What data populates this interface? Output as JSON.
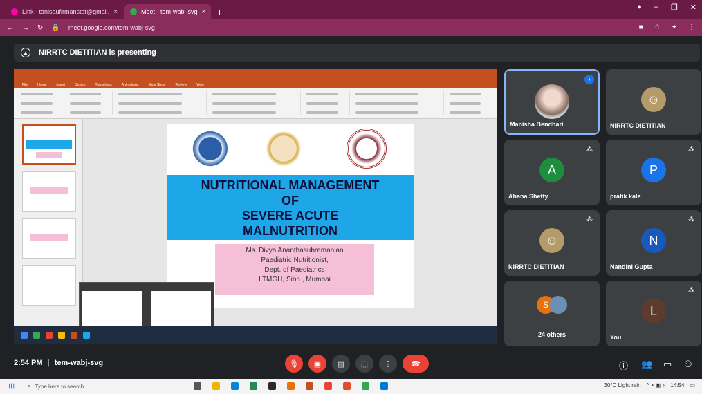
{
  "browser": {
    "tabs": [
      {
        "label": "Link - tanisaufirmanstaf@gmail.",
        "close": "×"
      },
      {
        "label": "Meet - tem-wabj-svg",
        "close": "×"
      }
    ],
    "new_tab": "+",
    "url": "meet.google.com/tem-wabj-svg",
    "window_controls": [
      "●",
      "–",
      "❐",
      "✕"
    ]
  },
  "meet": {
    "presenting_banner": "NIRRTC DIETITIAN is presenting",
    "time": "2:54 PM",
    "meeting_code": "tem-wabj-svg",
    "separator": "|",
    "participants": [
      {
        "name": "Manisha Bendhari",
        "type": "photo",
        "speaking": true
      },
      {
        "name": "NIRRTC DIETITIAN",
        "type": "logo"
      },
      {
        "name": "Ahana Shetty",
        "initial": "A",
        "color": "#1e8e3e"
      },
      {
        "name": "pratik kale",
        "initial": "P",
        "color": "#1a73e8"
      },
      {
        "name": "NIRRTC DIETITIAN",
        "type": "logo"
      },
      {
        "name": "Nandini Gupta",
        "initial": "N",
        "color": "#185abc"
      },
      {
        "name": "24 others",
        "initial": "S",
        "color": "#e8710a"
      },
      {
        "name": "You",
        "initial": "L",
        "color": "#5f3b2e"
      }
    ]
  },
  "slide": {
    "title_lines": [
      "NUTRITIONAL MANAGEMENT",
      "OF",
      "SEVERE ACUTE",
      "MALNUTRITION"
    ],
    "presenter_lines": [
      "Ms. Divya Ananthasubramanian",
      "Paediatric Nutritionist,",
      "Dept. of Paediatrics",
      "LTMGH, Sion , Mumbai"
    ]
  },
  "taskbar": {
    "search_placeholder": "Type here to search",
    "weather": "30°C Light rain",
    "clock": "14:54"
  },
  "colors": {
    "chrome": "#6b1a45",
    "ppt_orange": "#c4501f",
    "slide_blue": "#1ea7e8",
    "slide_pink": "#f6bfd8",
    "meet_red": "#ea4335"
  }
}
